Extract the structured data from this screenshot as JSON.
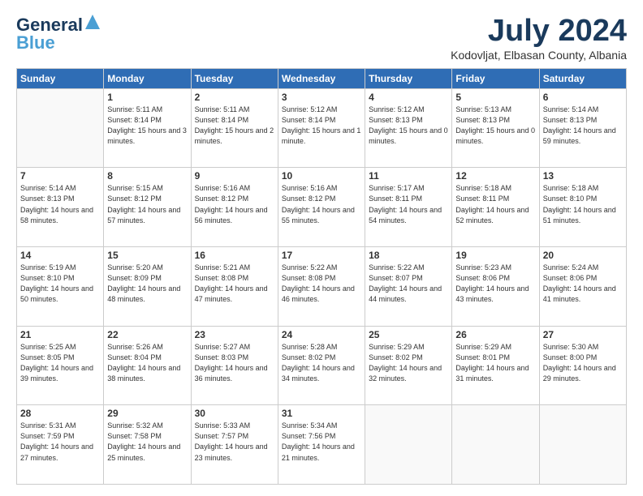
{
  "logo": {
    "line1": "General",
    "line2": "Blue"
  },
  "title": "July 2024",
  "subtitle": "Kodovljat, Elbasan County, Albania",
  "header_days": [
    "Sunday",
    "Monday",
    "Tuesday",
    "Wednesday",
    "Thursday",
    "Friday",
    "Saturday"
  ],
  "weeks": [
    [
      {
        "day": "",
        "sunrise": "",
        "sunset": "",
        "daylight": ""
      },
      {
        "day": "1",
        "sunrise": "Sunrise: 5:11 AM",
        "sunset": "Sunset: 8:14 PM",
        "daylight": "Daylight: 15 hours and 3 minutes."
      },
      {
        "day": "2",
        "sunrise": "Sunrise: 5:11 AM",
        "sunset": "Sunset: 8:14 PM",
        "daylight": "Daylight: 15 hours and 2 minutes."
      },
      {
        "day": "3",
        "sunrise": "Sunrise: 5:12 AM",
        "sunset": "Sunset: 8:14 PM",
        "daylight": "Daylight: 15 hours and 1 minute."
      },
      {
        "day": "4",
        "sunrise": "Sunrise: 5:12 AM",
        "sunset": "Sunset: 8:13 PM",
        "daylight": "Daylight: 15 hours and 0 minutes."
      },
      {
        "day": "5",
        "sunrise": "Sunrise: 5:13 AM",
        "sunset": "Sunset: 8:13 PM",
        "daylight": "Daylight: 15 hours and 0 minutes."
      },
      {
        "day": "6",
        "sunrise": "Sunrise: 5:14 AM",
        "sunset": "Sunset: 8:13 PM",
        "daylight": "Daylight: 14 hours and 59 minutes."
      }
    ],
    [
      {
        "day": "7",
        "sunrise": "Sunrise: 5:14 AM",
        "sunset": "Sunset: 8:13 PM",
        "daylight": "Daylight: 14 hours and 58 minutes."
      },
      {
        "day": "8",
        "sunrise": "Sunrise: 5:15 AM",
        "sunset": "Sunset: 8:12 PM",
        "daylight": "Daylight: 14 hours and 57 minutes."
      },
      {
        "day": "9",
        "sunrise": "Sunrise: 5:16 AM",
        "sunset": "Sunset: 8:12 PM",
        "daylight": "Daylight: 14 hours and 56 minutes."
      },
      {
        "day": "10",
        "sunrise": "Sunrise: 5:16 AM",
        "sunset": "Sunset: 8:12 PM",
        "daylight": "Daylight: 14 hours and 55 minutes."
      },
      {
        "day": "11",
        "sunrise": "Sunrise: 5:17 AM",
        "sunset": "Sunset: 8:11 PM",
        "daylight": "Daylight: 14 hours and 54 minutes."
      },
      {
        "day": "12",
        "sunrise": "Sunrise: 5:18 AM",
        "sunset": "Sunset: 8:11 PM",
        "daylight": "Daylight: 14 hours and 52 minutes."
      },
      {
        "day": "13",
        "sunrise": "Sunrise: 5:18 AM",
        "sunset": "Sunset: 8:10 PM",
        "daylight": "Daylight: 14 hours and 51 minutes."
      }
    ],
    [
      {
        "day": "14",
        "sunrise": "Sunrise: 5:19 AM",
        "sunset": "Sunset: 8:10 PM",
        "daylight": "Daylight: 14 hours and 50 minutes."
      },
      {
        "day": "15",
        "sunrise": "Sunrise: 5:20 AM",
        "sunset": "Sunset: 8:09 PM",
        "daylight": "Daylight: 14 hours and 48 minutes."
      },
      {
        "day": "16",
        "sunrise": "Sunrise: 5:21 AM",
        "sunset": "Sunset: 8:08 PM",
        "daylight": "Daylight: 14 hours and 47 minutes."
      },
      {
        "day": "17",
        "sunrise": "Sunrise: 5:22 AM",
        "sunset": "Sunset: 8:08 PM",
        "daylight": "Daylight: 14 hours and 46 minutes."
      },
      {
        "day": "18",
        "sunrise": "Sunrise: 5:22 AM",
        "sunset": "Sunset: 8:07 PM",
        "daylight": "Daylight: 14 hours and 44 minutes."
      },
      {
        "day": "19",
        "sunrise": "Sunrise: 5:23 AM",
        "sunset": "Sunset: 8:06 PM",
        "daylight": "Daylight: 14 hours and 43 minutes."
      },
      {
        "day": "20",
        "sunrise": "Sunrise: 5:24 AM",
        "sunset": "Sunset: 8:06 PM",
        "daylight": "Daylight: 14 hours and 41 minutes."
      }
    ],
    [
      {
        "day": "21",
        "sunrise": "Sunrise: 5:25 AM",
        "sunset": "Sunset: 8:05 PM",
        "daylight": "Daylight: 14 hours and 39 minutes."
      },
      {
        "day": "22",
        "sunrise": "Sunrise: 5:26 AM",
        "sunset": "Sunset: 8:04 PM",
        "daylight": "Daylight: 14 hours and 38 minutes."
      },
      {
        "day": "23",
        "sunrise": "Sunrise: 5:27 AM",
        "sunset": "Sunset: 8:03 PM",
        "daylight": "Daylight: 14 hours and 36 minutes."
      },
      {
        "day": "24",
        "sunrise": "Sunrise: 5:28 AM",
        "sunset": "Sunset: 8:02 PM",
        "daylight": "Daylight: 14 hours and 34 minutes."
      },
      {
        "day": "25",
        "sunrise": "Sunrise: 5:29 AM",
        "sunset": "Sunset: 8:02 PM",
        "daylight": "Daylight: 14 hours and 32 minutes."
      },
      {
        "day": "26",
        "sunrise": "Sunrise: 5:29 AM",
        "sunset": "Sunset: 8:01 PM",
        "daylight": "Daylight: 14 hours and 31 minutes."
      },
      {
        "day": "27",
        "sunrise": "Sunrise: 5:30 AM",
        "sunset": "Sunset: 8:00 PM",
        "daylight": "Daylight: 14 hours and 29 minutes."
      }
    ],
    [
      {
        "day": "28",
        "sunrise": "Sunrise: 5:31 AM",
        "sunset": "Sunset: 7:59 PM",
        "daylight": "Daylight: 14 hours and 27 minutes."
      },
      {
        "day": "29",
        "sunrise": "Sunrise: 5:32 AM",
        "sunset": "Sunset: 7:58 PM",
        "daylight": "Daylight: 14 hours and 25 minutes."
      },
      {
        "day": "30",
        "sunrise": "Sunrise: 5:33 AM",
        "sunset": "Sunset: 7:57 PM",
        "daylight": "Daylight: 14 hours and 23 minutes."
      },
      {
        "day": "31",
        "sunrise": "Sunrise: 5:34 AM",
        "sunset": "Sunset: 7:56 PM",
        "daylight": "Daylight: 14 hours and 21 minutes."
      },
      {
        "day": "",
        "sunrise": "",
        "sunset": "",
        "daylight": ""
      },
      {
        "day": "",
        "sunrise": "",
        "sunset": "",
        "daylight": ""
      },
      {
        "day": "",
        "sunrise": "",
        "sunset": "",
        "daylight": ""
      }
    ]
  ]
}
